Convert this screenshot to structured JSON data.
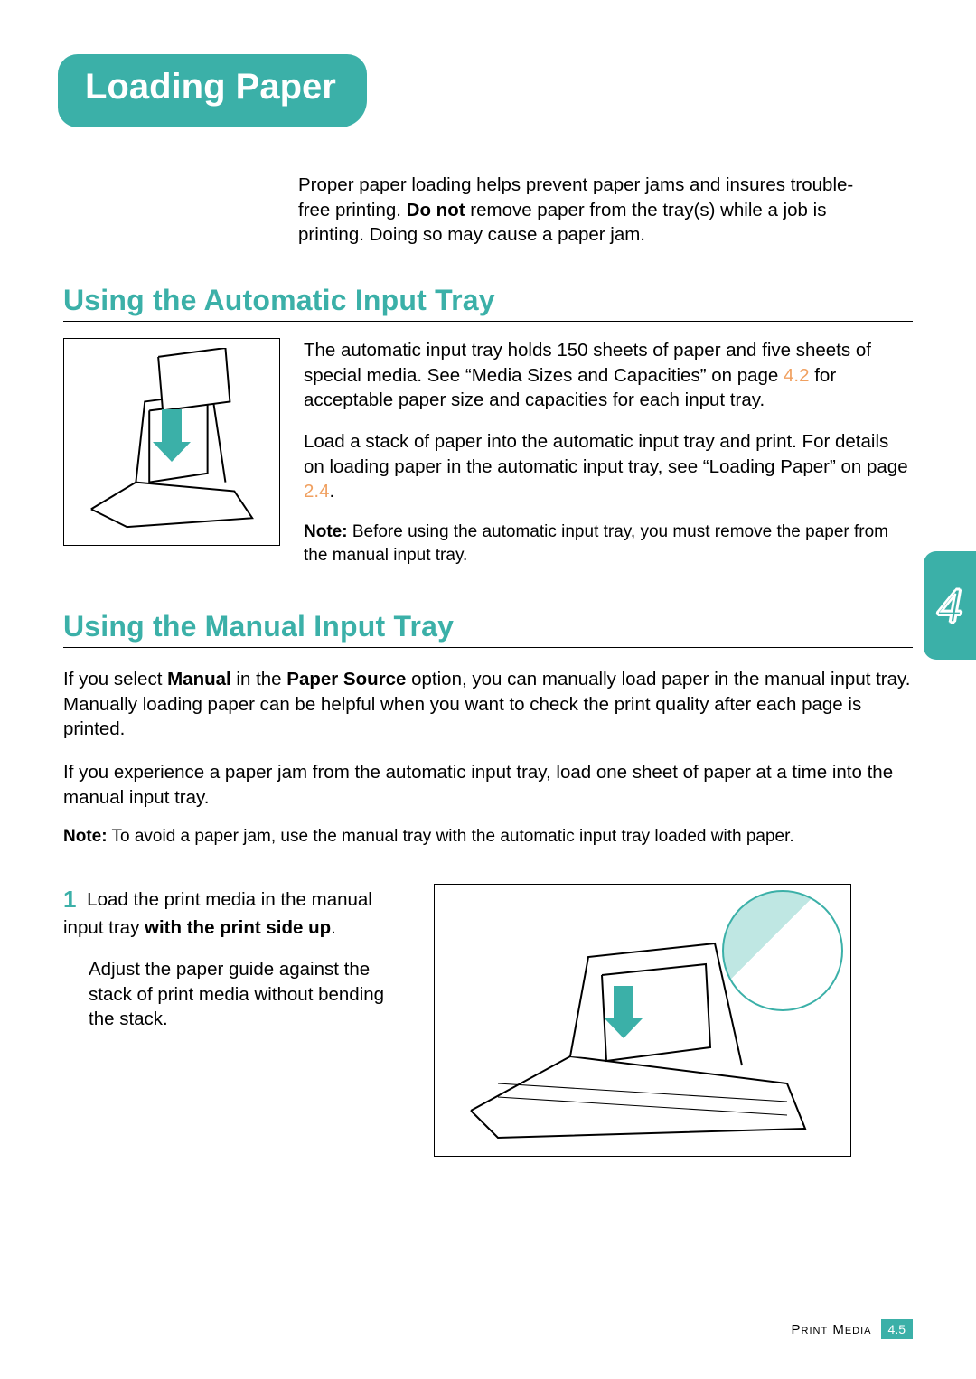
{
  "title": "Loading Paper",
  "intro": {
    "line1": "Proper paper loading helps prevent paper jams and insures trouble-free printing. ",
    "bold1": "Do not",
    "line2": " remove paper from the tray(s) while a job is printing. Doing so may cause a paper jam."
  },
  "section1": {
    "heading": "Using the Automatic Input Tray",
    "p1a": "The automatic input tray holds 150 sheets of paper and five sheets of special media. See “Media Sizes and Capacities” on page ",
    "p1link": "4.2",
    "p1b": " for acceptable paper size and capacities for each input tray.",
    "p2a": "Load a stack of paper into the automatic input tray and print. For details on loading paper in the automatic input tray, see “Loading Paper” on page ",
    "p2link": "2.4",
    "p2b": ".",
    "note_lead": "Note:",
    "note": " Before using the automatic input tray, you must remove the paper from the manual input tray."
  },
  "section2": {
    "heading": "Using the Manual Input Tray",
    "p1a": "If you select ",
    "p1b1": "Manual",
    "p1c": " in the ",
    "p1b2": "Paper Source",
    "p1d": " option, you can manually load paper in the manual input tray. Manually loading paper can be helpful when you want to check the print quality after each page is printed.",
    "p2": "If you experience a paper jam from the automatic input tray, load one sheet of paper at a time into the manual input tray.",
    "note_lead": "Note:",
    "note": " To avoid a paper jam, use the manual tray with the automatic input tray loaded with paper.",
    "step_num": "1",
    "step1a": "Load the print media in the manual input tray ",
    "step1bold": "with the print side up",
    "step1b": ".",
    "step1p2": "Adjust the paper guide against the stack of print media without bending the stack."
  },
  "chapter_tab": "4",
  "footer": {
    "label": "Print Media",
    "page_major": "4",
    "page_minor": ".5"
  }
}
